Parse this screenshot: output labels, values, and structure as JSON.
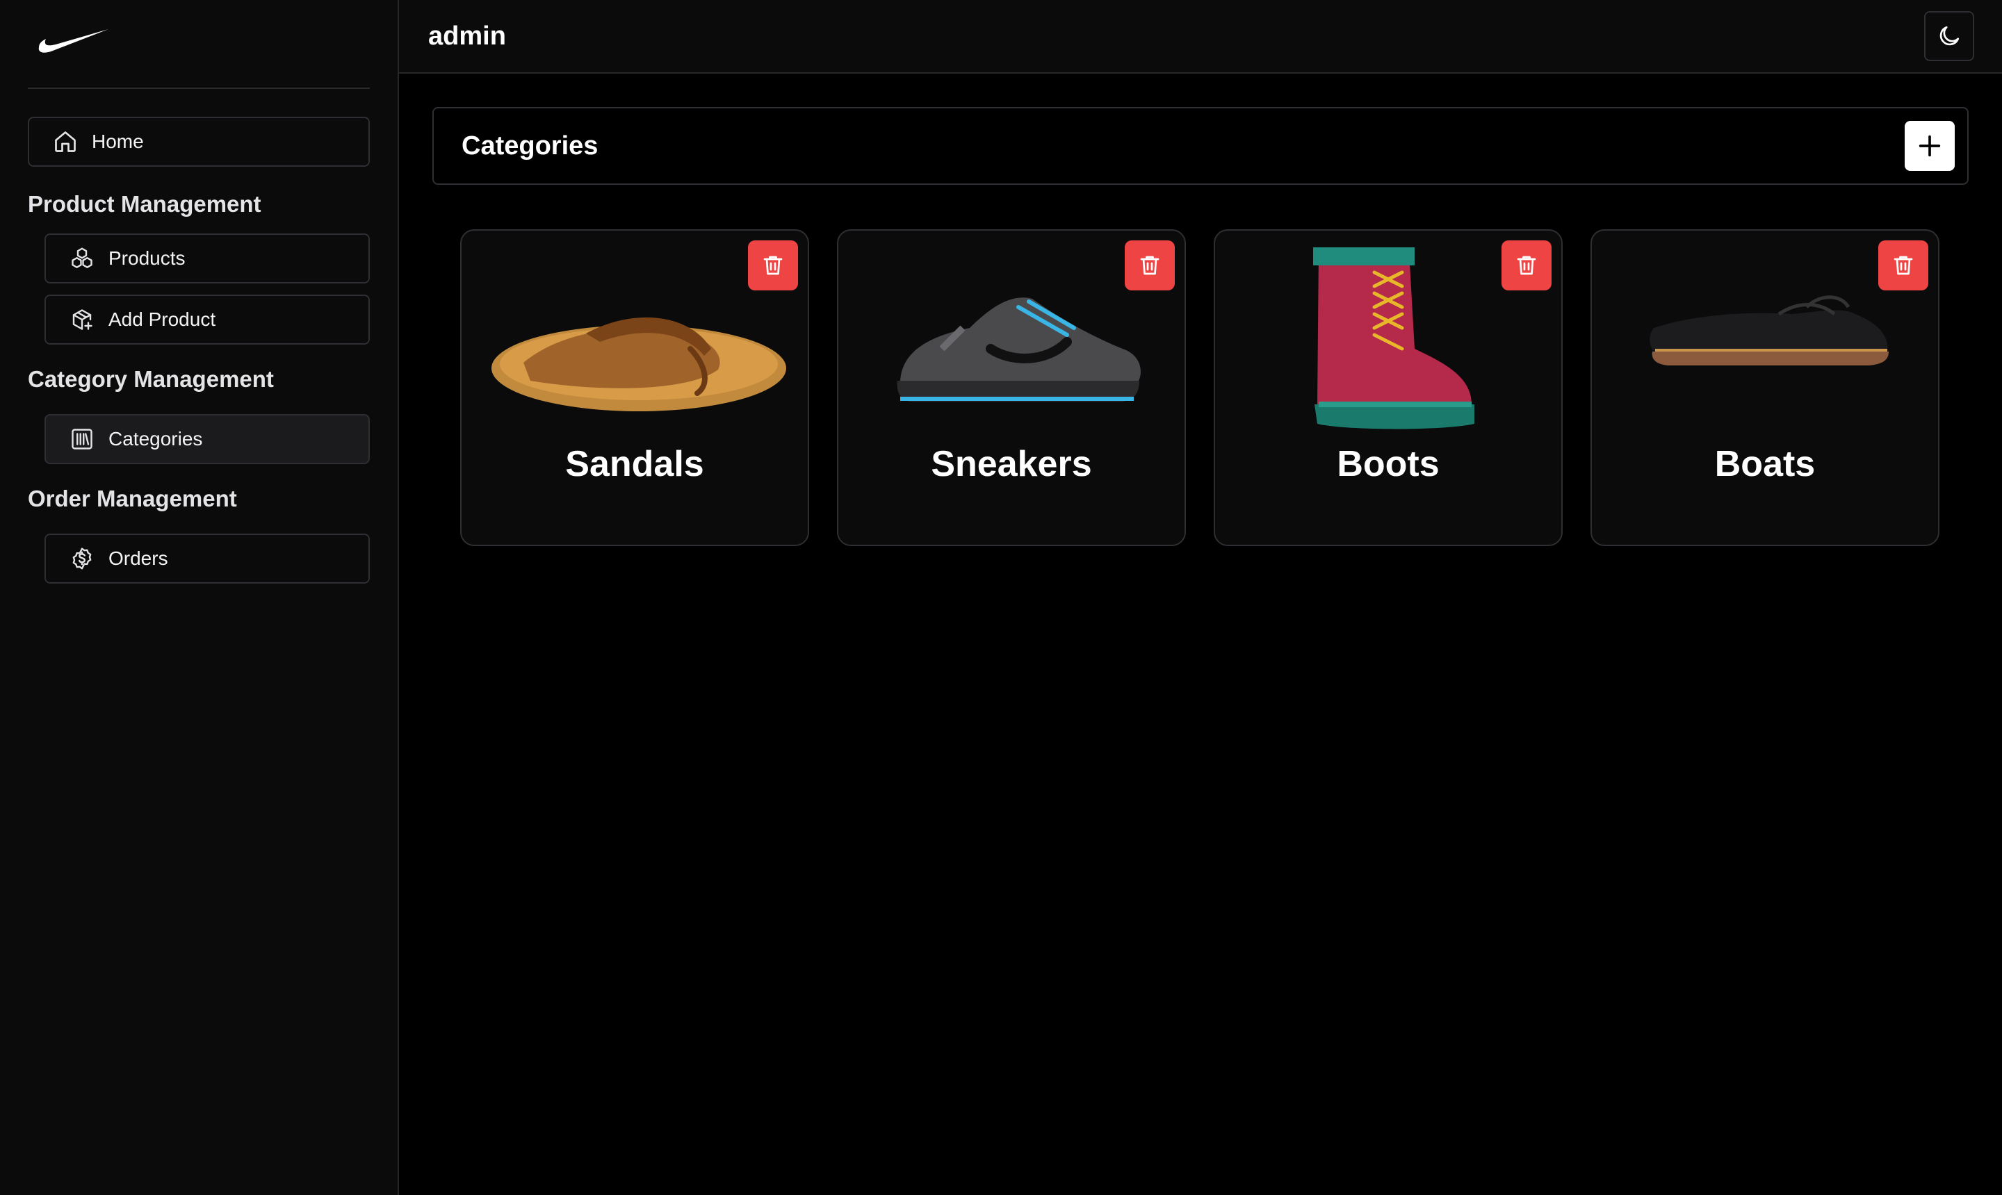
{
  "app": {
    "brand_icon": "swoosh-logo",
    "user_name": "admin"
  },
  "sidebar": {
    "home_label": "Home",
    "sections": [
      {
        "title": "Product Management",
        "items": [
          {
            "label": "Products",
            "icon": "cubes-icon"
          },
          {
            "label": "Add Product",
            "icon": "box-plus-icon"
          }
        ]
      },
      {
        "title": "Category Management",
        "items": [
          {
            "label": "Categories",
            "icon": "library-icon"
          }
        ]
      },
      {
        "title": "Order Management",
        "items": [
          {
            "label": "Orders",
            "icon": "dollar-circle-icon"
          }
        ]
      }
    ]
  },
  "main": {
    "title": "Categories",
    "add_icon": "plus-icon",
    "theme_icon": "moon-icon",
    "categories": [
      {
        "name": "Sandals",
        "image": "sandal-image"
      },
      {
        "name": "Sneakers",
        "image": "sneaker-image"
      },
      {
        "name": "Boots",
        "image": "boot-image"
      },
      {
        "name": "Boats",
        "image": "boat-shoe-image"
      }
    ]
  },
  "colors": {
    "background": "#000000",
    "sidebar": "#0b0b0c",
    "border": "#2f2f33",
    "danger": "#ef4444",
    "text": "#ffffff"
  }
}
